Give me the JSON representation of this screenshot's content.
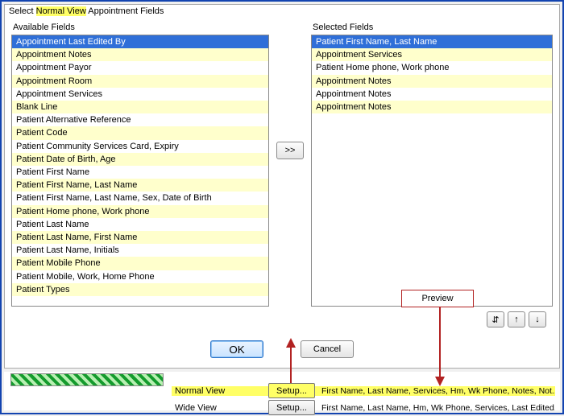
{
  "dialog": {
    "title_prefix": "Select ",
    "title_highlight": "Normal View",
    "title_suffix": " Appointment Fields"
  },
  "labels": {
    "available": "Available Fields",
    "selected": "Selected Fields",
    "preview": "Preview"
  },
  "buttons": {
    "move": ">>",
    "ok": "OK",
    "cancel": "Cancel",
    "sort_alpha": "⇵",
    "sort_up": "↑",
    "sort_down": "↓",
    "setup": "Setup..."
  },
  "available": [
    "Appointment Last Edited By",
    "Appointment Notes",
    "Appointment Payor",
    "Appointment Room",
    "Appointment Services",
    "Blank Line",
    "Patient Alternative Reference",
    "Patient Code",
    "Patient Community Services Card, Expiry",
    "Patient Date of Birth, Age",
    "Patient First Name",
    "Patient First Name, Last Name",
    "Patient First Name, Last Name, Sex, Date of Birth",
    "Patient Home phone, Work phone",
    "Patient Last Name",
    "Patient Last Name, First Name",
    "Patient Last Name, Initials",
    "Patient Mobile Phone",
    "Patient Mobile, Work, Home Phone",
    "Patient Types"
  ],
  "available_selected_index": 0,
  "selected": [
    "Patient First Name, Last Name",
    "Appointment Services",
    "Patient Home phone, Work phone",
    "Appointment Notes",
    "Appointment Notes",
    "Appointment Notes"
  ],
  "selected_selected_index": 0,
  "views": {
    "normal": {
      "label": "Normal View",
      "preview": "First Name, Last Name, Services, Hm, Wk Phone, Notes, Not..."
    },
    "wide": {
      "label": "Wide View",
      "preview": "First Name, Last Name, Hm, Wk Phone, Services, Last Edited..."
    }
  }
}
